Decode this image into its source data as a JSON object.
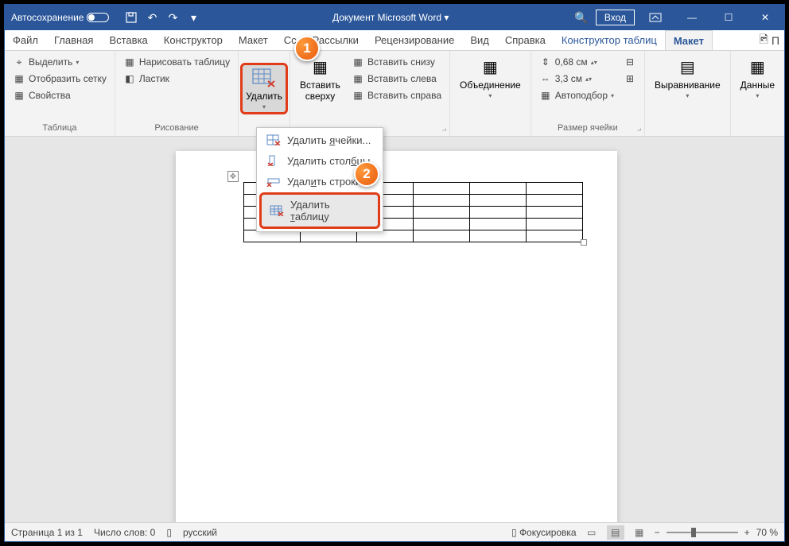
{
  "titlebar": {
    "autosave": "Автосохранение",
    "title": "Документ Microsoft Word  ▾",
    "search_icon": "🔍",
    "login": "Вход"
  },
  "tabs": {
    "file": "Файл",
    "home": "Главная",
    "insert": "Вставка",
    "designer": "Конструктор",
    "layout": "Макет",
    "refs": "Сс",
    "mail": "Рассылки",
    "review": "Рецензирование",
    "view": "Вид",
    "help": "Справка",
    "table_designer": "Конструктор таблиц",
    "table_layout": "Макет"
  },
  "ribbon": {
    "table": {
      "label": "Таблица",
      "select": "Выделить",
      "gridlines": "Отобразить сетку",
      "properties": "Свойства"
    },
    "drawing": {
      "label": "Рисование",
      "draw": "Нарисовать таблицу",
      "eraser": "Ластик"
    },
    "delete": {
      "label": "Удалить"
    },
    "insert": {
      "above": "Вставить сверху",
      "below": "Вставить снизу",
      "left": "Вставить слева",
      "right": "Вставить справа"
    },
    "merge": {
      "label": "Объединение"
    },
    "cellsize": {
      "label": "Размер ячейки",
      "height": "0,68 см",
      "width": "3,3 см",
      "autofit": "Автоподбор"
    },
    "align": {
      "label": "Выравнивание"
    },
    "data": {
      "label": "Данные"
    }
  },
  "menu": {
    "delete_cells": "Удалить ячейки...",
    "delete_cols": "Удалить столбцы",
    "delete_rows": "Удалить строки",
    "delete_table": "Удалить таблицу"
  },
  "badges": {
    "one": "1",
    "two": "2"
  },
  "status": {
    "page": "Страница 1 из 1",
    "words": "Число слов: 0",
    "lang": "русский",
    "focus": "Фокусировка",
    "zoom": "70 %"
  }
}
